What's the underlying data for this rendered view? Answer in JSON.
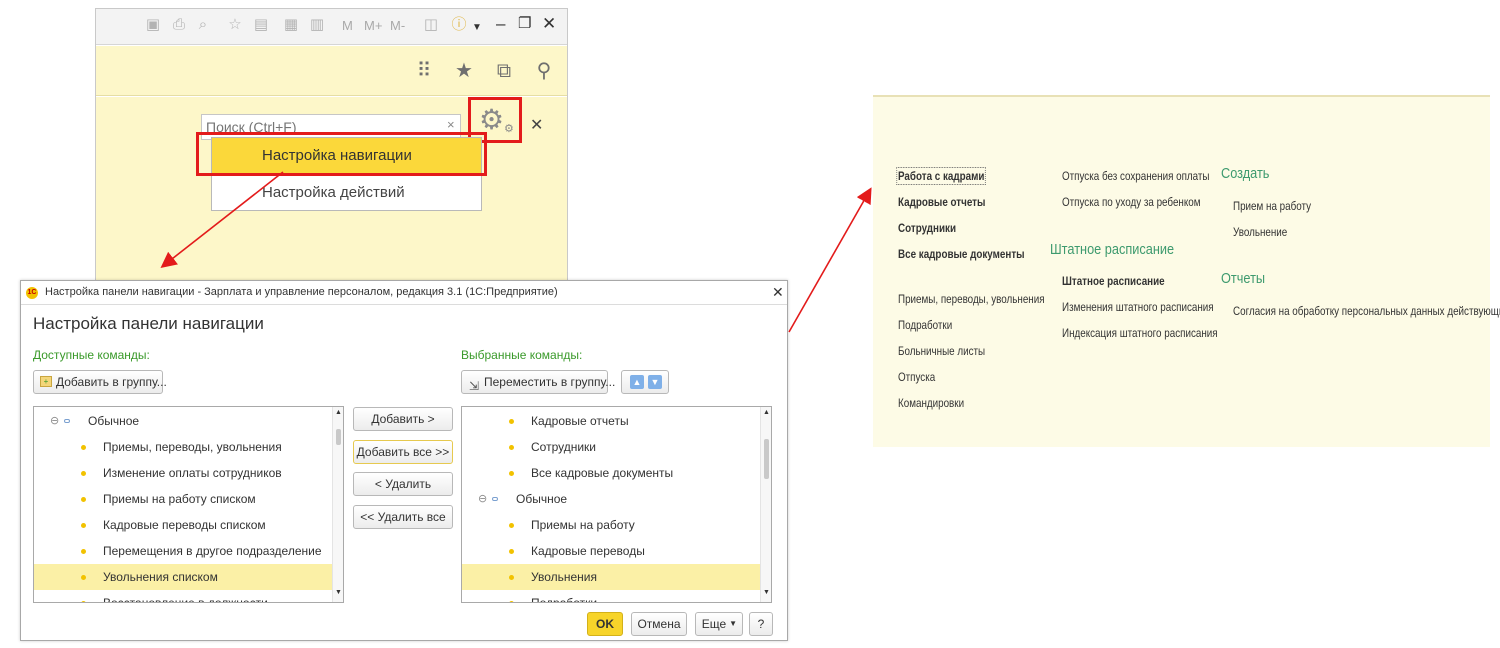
{
  "app": {
    "toolbar_texts": [
      "M",
      "M+",
      "M-"
    ],
    "search_placeholder": "Поиск (Ctrl+F)",
    "menu_items": [
      "Настройка навигации",
      "Настройка действий"
    ]
  },
  "dialog": {
    "window_title": "Настройка панели навигации - Зарплата и управление персоналом, редакция 3.1  (1С:Предприятие)",
    "heading": "Настройка панели навигации",
    "available_label": "Доступные команды:",
    "selected_label": "Выбранные команды:",
    "add_to_group": "Добавить в группу...",
    "move_to_group": "Переместить в группу...",
    "available_items": [
      {
        "text": "Обычное",
        "type": "group"
      },
      {
        "text": "Приемы, переводы, увольнения",
        "type": "item"
      },
      {
        "text": "Изменение оплаты сотрудников",
        "type": "item"
      },
      {
        "text": "Приемы на работу списком",
        "type": "item"
      },
      {
        "text": "Кадровые переводы списком",
        "type": "item"
      },
      {
        "text": "Перемещения в другое подразделение",
        "type": "item"
      },
      {
        "text": "Увольнения списком",
        "type": "item",
        "selected": true
      },
      {
        "text": "Восстановление в должности",
        "type": "item"
      }
    ],
    "selected_items": [
      {
        "text": "Кадровые отчеты",
        "type": "item"
      },
      {
        "text": "Сотрудники",
        "type": "item"
      },
      {
        "text": "Все кадровые документы",
        "type": "item"
      },
      {
        "text": "Обычное",
        "type": "group"
      },
      {
        "text": "Приемы на работу",
        "type": "item"
      },
      {
        "text": "Кадровые переводы",
        "type": "item"
      },
      {
        "text": "Увольнения",
        "type": "item",
        "selected": true
      },
      {
        "text": "Подработки",
        "type": "item"
      }
    ],
    "buttons": {
      "add": "Добавить >",
      "add_all": "Добавить все >>",
      "remove": "< Удалить",
      "remove_all": "<< Удалить все",
      "ok": "OK",
      "cancel": "Отмена",
      "more": "Еще",
      "help": "?"
    }
  },
  "nav_panel": {
    "col1_bold": [
      "Работа с кадрами",
      "Кадровые отчеты",
      "Сотрудники",
      "Все кадровые документы"
    ],
    "col1_items": [
      "Приемы, переводы, увольнения",
      "Подработки",
      "Больничные листы",
      "Отпуска",
      "Командировки"
    ],
    "col2_items": [
      "Отпуска без сохранения оплаты",
      "Отпуска по уходу за ребенком"
    ],
    "col2_heading": "Штатное расписание",
    "col2_bold": "Штатное расписание",
    "col2_sub": [
      "Изменения штатного расписания",
      "Индексация штатного расписания"
    ],
    "col3_heading1": "Создать",
    "col3_create": [
      "Прием на работу",
      "Увольнение"
    ],
    "col3_heading2": "Отчеты",
    "col3_reports": [
      "Согласия на обработку персональных данных действующие"
    ]
  },
  "colors": {
    "highlight_red": "#e31b1b",
    "accent_yellow": "#fbd83a",
    "panel_yellow": "#fdf7c9",
    "green_label": "#3a9a2a",
    "nav_heading": "#3d9a6e"
  }
}
